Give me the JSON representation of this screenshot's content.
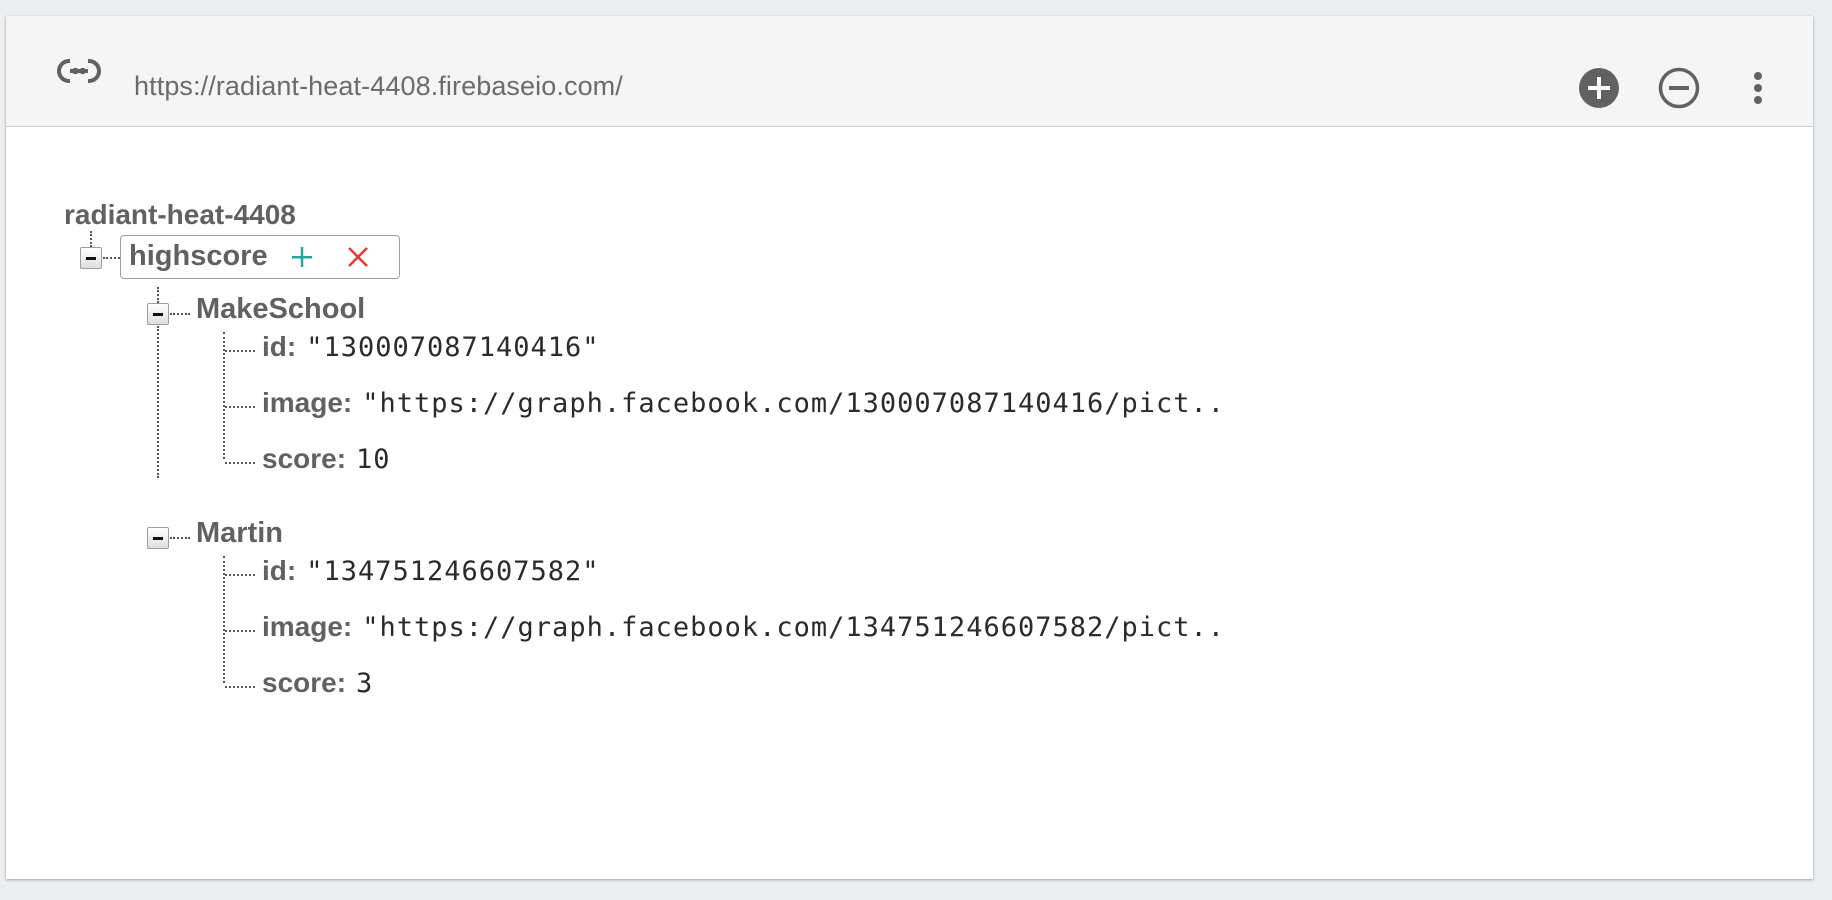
{
  "toolbar": {
    "url": "https://radiant-heat-4408.firebaseio.com/",
    "icons": {
      "link": "link-icon",
      "add": "add-circle-icon",
      "remove": "remove-circle-icon",
      "more": "more-vert-icon"
    }
  },
  "colors": {
    "add_accent": "#26a69a",
    "delete_accent": "#e53935",
    "toolbar_icon": "#616161"
  },
  "tree": {
    "root": "radiant-heat-4408",
    "highscore": {
      "label": "highscore",
      "children": [
        {
          "name": "MakeSchool",
          "fields": [
            {
              "key": "id:",
              "value": "\"130007087140416\""
            },
            {
              "key": "image:",
              "value": "\"https://graph.facebook.com/130007087140416/pict.."
            },
            {
              "key": "score:",
              "value": "10"
            }
          ]
        },
        {
          "name": "Martin",
          "fields": [
            {
              "key": "id:",
              "value": "\"134751246607582\""
            },
            {
              "key": "image:",
              "value": "\"https://graph.facebook.com/134751246607582/pict.."
            },
            {
              "key": "score:",
              "value": "3"
            }
          ]
        }
      ]
    }
  }
}
